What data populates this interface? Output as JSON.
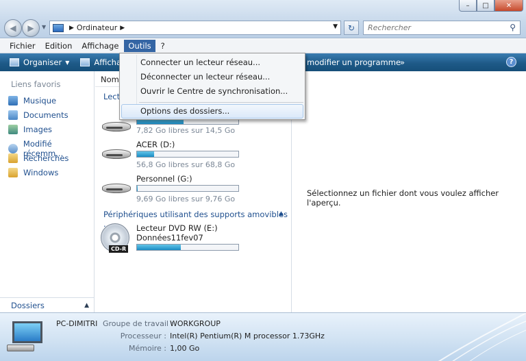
{
  "window": {
    "min_glyph": "–",
    "max_glyph": "□",
    "close_glyph": "✕"
  },
  "address": {
    "breadcrumb": "Ordinateur",
    "search_placeholder": "Rechercher"
  },
  "menubar": {
    "items": [
      "Fichier",
      "Edition",
      "Affichage",
      "Outils",
      "?"
    ],
    "active": "Outils"
  },
  "toolbar": {
    "organiser": "Organiser",
    "affichage": "Affichage",
    "modify_program": "modifier un programme",
    "more": "»",
    "help": "?"
  },
  "nav": {
    "heading": "Liens favoris",
    "favorites": [
      "Musique",
      "Documents",
      "Images",
      "Modifié récemm...",
      "Recherches",
      "Windows"
    ],
    "dossiers": "Dossiers"
  },
  "content": {
    "column_header": "Nom",
    "group_head": "Lect",
    "drives": [
      {
        "name": "",
        "free": "7,82 Go libres sur 14,5 Go",
        "used_fraction": 0.46
      },
      {
        "name": "ACER (D:)",
        "free": "56,8 Go libres sur 68,8 Go",
        "used_fraction": 0.17
      },
      {
        "name": "Personnel (G:)",
        "free": "9,69 Go libres sur 9,76 Go",
        "used_fraction": 0.01
      }
    ],
    "removable_group": "Périphériques utilisant des supports amovibles ...",
    "dvd": {
      "name": "Lecteur DVD RW (E:)",
      "label": "Données11fev07",
      "used_fraction": 0.43,
      "badge": "CD-R"
    }
  },
  "preview": {
    "message": "Sélectionnez un fichier dont vous voulez afficher l'aperçu."
  },
  "dropdown": {
    "items": [
      "Connecter un lecteur réseau...",
      "Déconnecter un lecteur réseau...",
      "Ouvrir le Centre de synchronisation...",
      "Options des dossiers..."
    ],
    "highlighted": "Options des dossiers..."
  },
  "details": {
    "pc_name": "PC-DIMITRI",
    "workgroup_label": "Groupe de travail :",
    "workgroup_value": "WORKGROUP",
    "processor_label": "Processeur :",
    "processor_value": "Intel(R) Pentium(R) M processor 1.73GHz",
    "memory_label": "Mémoire :",
    "memory_value": "1,00 Go"
  },
  "colors": {
    "toolbar": "#1e5a88",
    "menu_active": "#3465a4",
    "link": "#1f4f8e",
    "bar_fill": "#1a8cc4"
  }
}
